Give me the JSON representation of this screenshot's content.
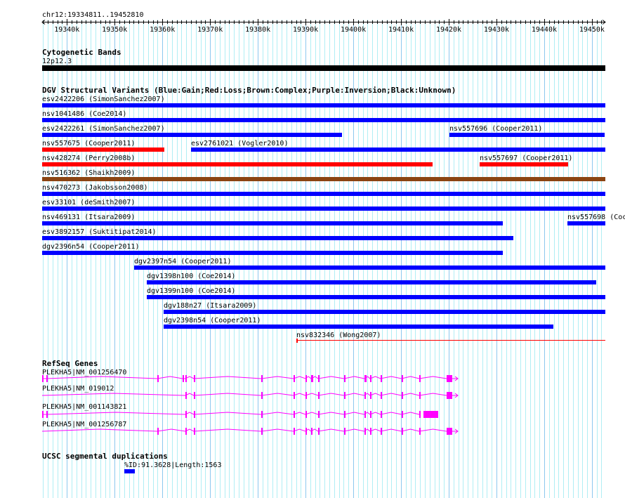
{
  "ruler": {
    "region": "chr12:19334811..19452810",
    "start": 19334811,
    "end": 19452810,
    "ticks": [
      "19340k",
      "19350k",
      "19360k",
      "19370k",
      "19380k",
      "19390k",
      "19400k",
      "19410k",
      "19420k",
      "19430k",
      "19440k",
      "19450k"
    ]
  },
  "colors": {
    "gain": "#0000ff",
    "loss": "#ff0000",
    "complex": "#8b4513",
    "band": "#000000",
    "gene": "#ff00ff",
    "grid_minor": "#b0eef4",
    "grid_major": "#8cc8ee"
  },
  "cytoband": {
    "title": "Cytogenetic Bands",
    "label": "12p12.3"
  },
  "dgv": {
    "title": "DGV Structural Variants (Blue:Gain;Red:Loss;Brown:Complex;Purple:Inversion;Black:Unknown)",
    "variants": [
      {
        "row": 0,
        "label": "esv2422206 (SimonSanchez2007)",
        "type": "gain",
        "start": 19334811,
        "end": 19452810
      },
      {
        "row": 1,
        "label": "nsv1041486 (Coe2014)",
        "type": "gain",
        "start": 19334811,
        "end": 19452810
      },
      {
        "row": 2,
        "label": "esv2422261 (SimonSanchez2007)",
        "type": "gain",
        "start": 19334811,
        "end": 19397605
      },
      {
        "row": 2,
        "label": "nsv557696 (Cooper2011)",
        "type": "gain",
        "start": 19420105,
        "end": 19452700
      },
      {
        "row": 3,
        "label": "nsv557675 (Cooper2011)",
        "type": "loss",
        "start": 19334811,
        "end": 19360399
      },
      {
        "row": 3,
        "label": "esv2761021 (Vogler2010)",
        "type": "gain",
        "start": 19365987,
        "end": 19452810
      },
      {
        "row": 4,
        "label": "nsv428274 (Perry2008b)",
        "type": "loss",
        "start": 19334811,
        "end": 19416576
      },
      {
        "row": 4,
        "label": "nsv557697 (Cooper2011)",
        "type": "loss",
        "start": 19426429,
        "end": 19444958
      },
      {
        "row": 5,
        "label": "nsv516362 (Shaikh2009)",
        "type": "complex",
        "start": 19334811,
        "end": 19452810
      },
      {
        "row": 6,
        "label": "nsv470273 (Jakobsson2008)",
        "type": "gain",
        "start": 19334811,
        "end": 19452810
      },
      {
        "row": 7,
        "label": "esv33101 (deSmith2007)",
        "type": "gain",
        "start": 19334811,
        "end": 19452810
      },
      {
        "row": 8,
        "label": "nsv469131 (Itsara2009)",
        "type": "gain",
        "start": 19334811,
        "end": 19431282
      },
      {
        "row": 8,
        "label": "nsv557698 (Coc",
        "type": "gain",
        "start": 19444811,
        "end": 19452810
      },
      {
        "row": 9,
        "label": "esv3892157 (Suktitipat2014)",
        "type": "gain",
        "start": 19334811,
        "end": 19433487
      },
      {
        "row": 10,
        "label": "dgv2396n54 (Cooper2011)",
        "type": "gain",
        "start": 19334811,
        "end": 19431282
      },
      {
        "row": 11,
        "label": "dgv2397n54 (Cooper2011)",
        "type": "gain",
        "start": 19354076,
        "end": 19452810
      },
      {
        "row": 12,
        "label": "dgv1398n100 (Coe2014)",
        "type": "gain",
        "start": 19356723,
        "end": 19450840
      },
      {
        "row": 13,
        "label": "dgv1399n100 (Coe2014)",
        "type": "gain",
        "start": 19356723,
        "end": 19452810
      },
      {
        "row": 14,
        "label": "dgv188n27 (Itsara2009)",
        "type": "gain",
        "start": 19360252,
        "end": 19452810
      },
      {
        "row": 15,
        "label": "dgv2398n54 (Cooper2011)",
        "type": "gain",
        "start": 19360252,
        "end": 19441870
      },
      {
        "row": 16,
        "label": "nsv832346 (Wong2007)",
        "type": "loss-thin",
        "start": 19388046,
        "end": 19452810
      }
    ]
  },
  "refseq": {
    "title": "RefSeq Genes",
    "genes": [
      {
        "label": "PLEKHA5|NM_001256470"
      },
      {
        "label": "PLEKHA5|NM_019012"
      },
      {
        "label": "PLEKHA5|NM_001143821"
      },
      {
        "label": "PLEKHA5|NM_001256787"
      }
    ]
  },
  "segdup": {
    "title": "UCSC segmental duplications",
    "label": "%ID:91.3628|Length:1563"
  }
}
